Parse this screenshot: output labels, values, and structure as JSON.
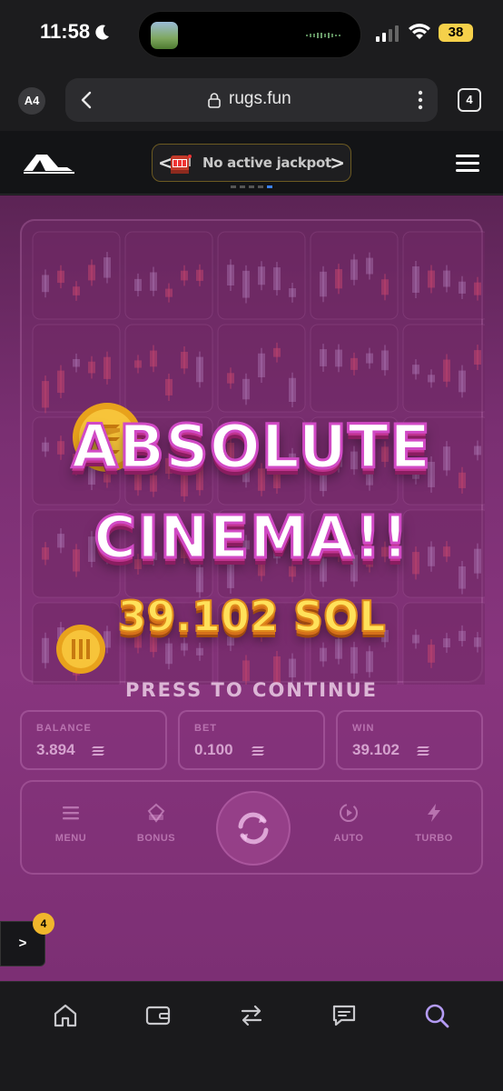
{
  "status_bar": {
    "time": "11:58",
    "battery": "38"
  },
  "browser": {
    "profile": "A4",
    "url": "rugs.fun",
    "tab_count": "4"
  },
  "header": {
    "jackpot_text": "No active jackpot",
    "jackpot_prev": "<",
    "jackpot_next": ">"
  },
  "result": {
    "line1": "ABSOLUTE",
    "line2": "CINEMA!!",
    "amount": "39.102 SOL",
    "press_text": "PRESS TO CONTINUE"
  },
  "stats": [
    {
      "label": "BALANCE",
      "value": "3.894"
    },
    {
      "label": "BET",
      "value": "0.100"
    },
    {
      "label": "WIN",
      "value": "39.102"
    }
  ],
  "controls": [
    {
      "label": "MENU",
      "icon": "menu-icon"
    },
    {
      "label": "BONUS",
      "icon": "bonus-icon"
    },
    {
      "label": "AUTO",
      "icon": "auto-icon"
    },
    {
      "label": "TURBO",
      "icon": "turbo-icon"
    }
  ],
  "drawer": {
    "label": ">",
    "badge": "4"
  },
  "bottom_nav": [
    "home-icon",
    "wallet-icon",
    "swap-icon",
    "chat-icon",
    "search-icon"
  ],
  "colors": {
    "accent": "#d14ac5",
    "gold": "#ffe15a",
    "background": "#7a2f72",
    "active_nav": "#b59cf5"
  }
}
